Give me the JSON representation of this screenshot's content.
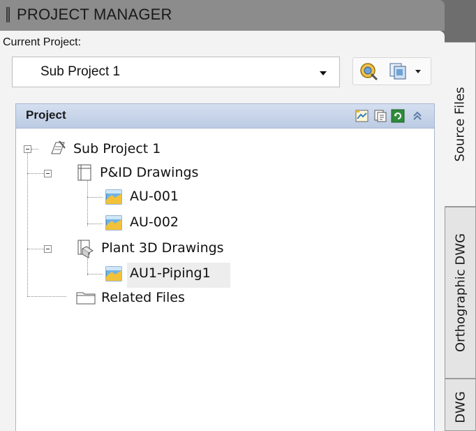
{
  "title": "PROJECT MANAGER",
  "current_project_label": "Current Project:",
  "current_project_value": "Sub Project 1",
  "section_title": "Project",
  "tree": {
    "root": "Sub Project 1",
    "pid_folder": "P&ID Drawings",
    "pid_items": [
      "AU-001",
      "AU-002"
    ],
    "plant3d_folder": "Plant 3D Drawings",
    "plant3d_items": [
      "AU1-Piping1"
    ],
    "related": "Related Files"
  },
  "tabs": [
    "Source Files",
    "Orthographic DWG",
    "DWG"
  ],
  "icons": {
    "project_settings": "project-settings-icon",
    "project_actions": "project-actions-icon",
    "new_drawing": "new-drawing-icon",
    "copy_drawing": "copy-drawing-icon",
    "refresh": "refresh-icon",
    "collapse": "collapse-chevron-icon"
  }
}
